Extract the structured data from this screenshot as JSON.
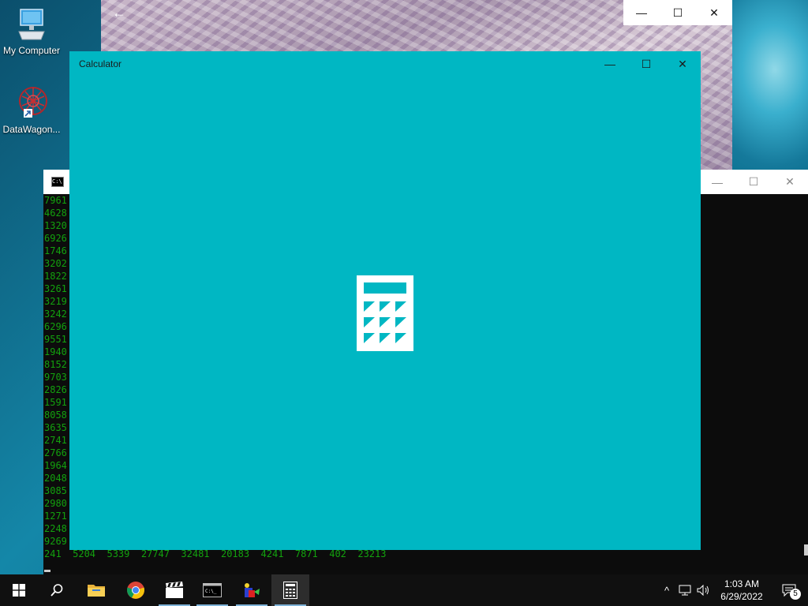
{
  "desktop": {
    "icons": [
      {
        "label": "My Computer"
      },
      {
        "label": "DataWagon..."
      }
    ]
  },
  "photo_window": {
    "back_glyph": "←",
    "controls": {
      "minimize": "—",
      "maximize": "☐",
      "close": "✕"
    }
  },
  "console": {
    "icon_text": "C:\\",
    "controls": {
      "minimize": "—",
      "maximize": "☐",
      "close": "✕"
    },
    "lines": [
      "7961",
      "4628",
      "1320",
      "6926",
      "1746",
      "3202",
      "1822",
      "3261",
      "3219",
      "3242",
      "6296",
      "9551",
      "1940",
      "8152",
      "9703",
      "2826",
      "1591",
      "8058",
      "3635",
      "2741",
      "2766",
      "1964",
      "2048",
      "3085",
      "2980",
      "1271",
      "2248",
      "9269"
    ],
    "last_line": "241  5204  5339  27747  32481  20183  4241  7871  402  23213",
    "text_color": "#13a10e"
  },
  "calculator": {
    "title": "Calculator",
    "controls": {
      "minimize": "—",
      "maximize": "☐",
      "close": "✕"
    },
    "background": "#00b7c3",
    "splash_icon": "calculator-icon"
  },
  "taskbar": {
    "clock": {
      "time": "1:03 AM",
      "date": "6/29/2022"
    },
    "notification_count": "5",
    "chevron": "^"
  }
}
